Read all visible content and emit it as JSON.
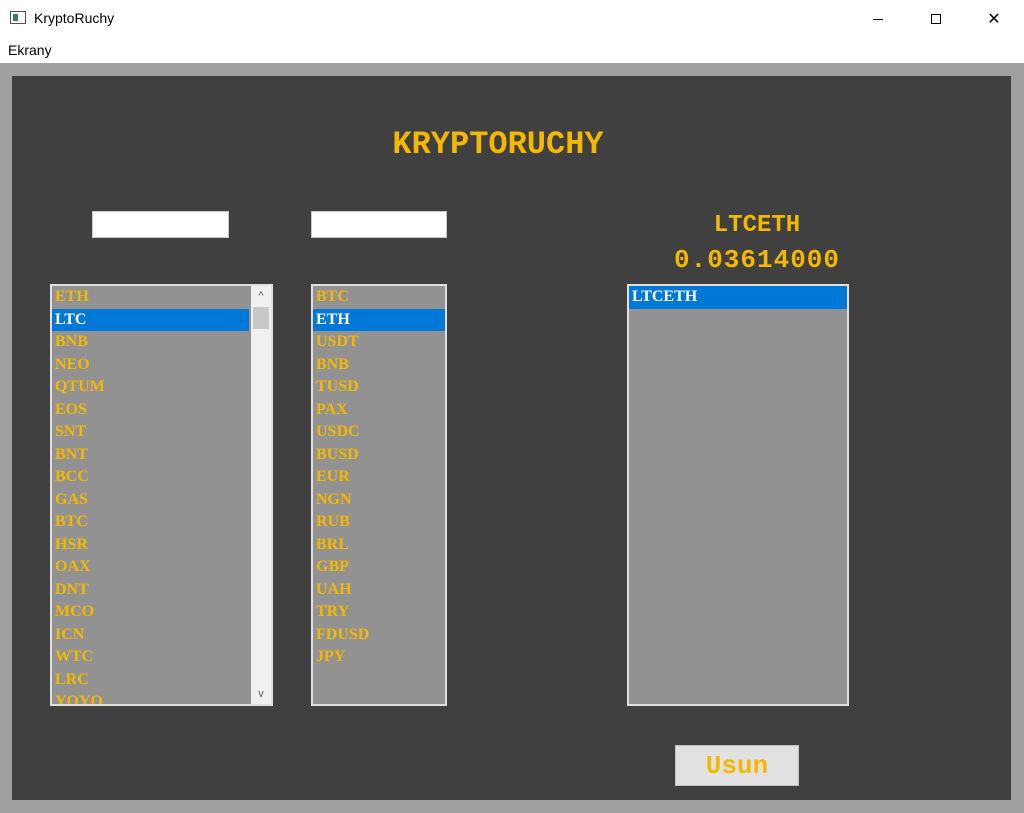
{
  "window": {
    "title": "KryptoRuchy",
    "minimize_icon": "minimize-icon",
    "maximize_icon": "maximize-icon",
    "close_icon": "close-icon",
    "close_glyph": "✕"
  },
  "menu": {
    "items": [
      "Ekrany"
    ]
  },
  "main": {
    "heading": "KRYPTORUCHY",
    "base_filter_value": "",
    "quote_filter_value": "",
    "selected_pair": "LTCETH",
    "selected_price": "0.03614000",
    "remove_button": "Usun",
    "scroll_up_glyph": "^",
    "scroll_down_glyph": "v"
  },
  "colors": {
    "accent": "#f5b800",
    "selection": "#0078d7",
    "panel": "#404040",
    "list_bg": "#929292"
  },
  "lists": {
    "base": {
      "selected_index": 1,
      "items": [
        "ETH",
        "LTC",
        "BNB",
        "NEO",
        "QTUM",
        "EOS",
        "SNT",
        "BNT",
        "BCC",
        "GAS",
        "BTC",
        "HSR",
        "OAX",
        "DNT",
        "MCO",
        "ICN",
        "WTC",
        "LRC",
        "YOYO"
      ]
    },
    "quote": {
      "selected_index": 1,
      "items": [
        "BTC",
        "ETH",
        "USDT",
        "BNB",
        "TUSD",
        "PAX",
        "USDC",
        "BUSD",
        "EUR",
        "NGN",
        "RUB",
        "BRL",
        "GBP",
        "UAH",
        "TRY",
        "FDUSD",
        "JPY"
      ]
    },
    "pairs": {
      "selected_index": 0,
      "items": [
        "LTCETH"
      ]
    }
  }
}
